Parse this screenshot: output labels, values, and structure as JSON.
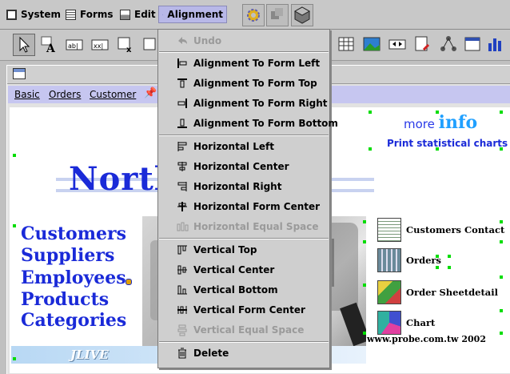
{
  "menubar": {
    "items": [
      {
        "label": "System",
        "icon": "system-icon"
      },
      {
        "label": "Forms",
        "icon": "forms-icon"
      },
      {
        "label": "Edit",
        "icon": "edit-icon"
      },
      {
        "label": "Alignment",
        "icon": "alignment-icon",
        "active": true
      }
    ]
  },
  "navbar": {
    "items": [
      "Basic",
      "Orders",
      "Customer"
    ]
  },
  "form": {
    "title": "North",
    "categories": [
      "Customers",
      "Suppliers",
      "Employees",
      "Products",
      "Categories"
    ],
    "more_label": "more",
    "info_label": "info",
    "print_statistical": "Print statistical charts",
    "side_items": [
      "Customers Contact",
      "Orders",
      "Order Sheetdetail",
      "Chart"
    ],
    "copyright": "www.probe.com.tw  2002",
    "banner": "JLIVE"
  },
  "alignment_menu": {
    "undo": "Undo",
    "group1": [
      "Alignment To Form Left",
      "Alignment To Form Top",
      "Alignment To Form Right",
      "Alignment To Form Bottom"
    ],
    "group2": [
      "Horizontal Left",
      "Horizontal Center",
      "Horizontal Right",
      "Horizontal Form Center",
      "Horizontal Equal Space"
    ],
    "group3": [
      "Vertical Top",
      "Vertical Center",
      "Vertical Bottom",
      "Vertical Form Center",
      "Vertical Equal Space"
    ],
    "delete": "Delete",
    "disabled": [
      "Undo",
      "Horizontal Equal Space",
      "Vertical Equal Space"
    ]
  },
  "colors": {
    "accent": "#1a2ad8",
    "menu_active": "#b8b8e8",
    "nav_bg": "#c6c6f0",
    "handle": "#00dd00"
  }
}
